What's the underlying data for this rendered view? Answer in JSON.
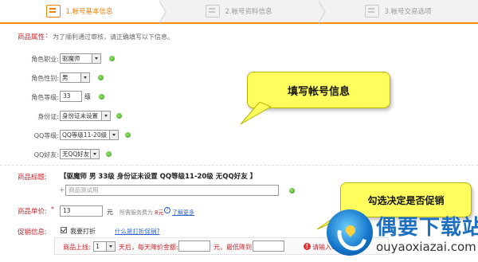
{
  "steps": [
    {
      "label": "1.帐号基本信息",
      "active": true
    },
    {
      "label": "2.帐号资料信息",
      "active": false
    },
    {
      "label": "3.帐号交易选项",
      "active": false
    }
  ],
  "attr_section": {
    "title": "商品属性",
    "colon": ":",
    "hint": "为了顺利通过审核，请正确填写以下信息。"
  },
  "fields": {
    "profession": {
      "label": "角色职业:",
      "value": "驱魔师"
    },
    "gender": {
      "label": "角色性别:",
      "value": "男"
    },
    "level": {
      "label": "角色等级:",
      "value": "33",
      "unit": "级"
    },
    "id_card": {
      "label": "身份证:",
      "value": "身份证未设置"
    },
    "qq_level": {
      "label": "QQ等级:",
      "value": "QQ等级11-20级"
    },
    "qq_friend": {
      "label": "QQ好友:",
      "value": "无QQ好友"
    }
  },
  "callouts": {
    "fill_account": "填写帐号信息",
    "promo_decide": "勾选决定是否促销"
  },
  "title_section": {
    "label": "商品标题:",
    "value": "【驱魔师 男 33级 身份证未设置 QQ等级11-20级 无QQ好友 】",
    "plus": "+",
    "placeholder": "商品测试用"
  },
  "price_section": {
    "label": "商品单价:",
    "required": "*",
    "value": "13",
    "unit": "元",
    "fee_text_prefix": "所需服务费为",
    "fee_amount": "8元",
    "more_link": "了解更多"
  },
  "promo_section": {
    "label": "促销信息:",
    "checkbox_label": "我要打折",
    "what_link": "什么是打折促销?",
    "row": {
      "shelf_label": "商品上线:",
      "days_value": "1",
      "days_suffix": "天后，每天降价金额:",
      "unit1": "元，最低降到",
      "warning": "请输入每天降价金"
    }
  },
  "watermark": {
    "cn": "偶要下载站",
    "en": "ouyaoxiazai.com"
  }
}
